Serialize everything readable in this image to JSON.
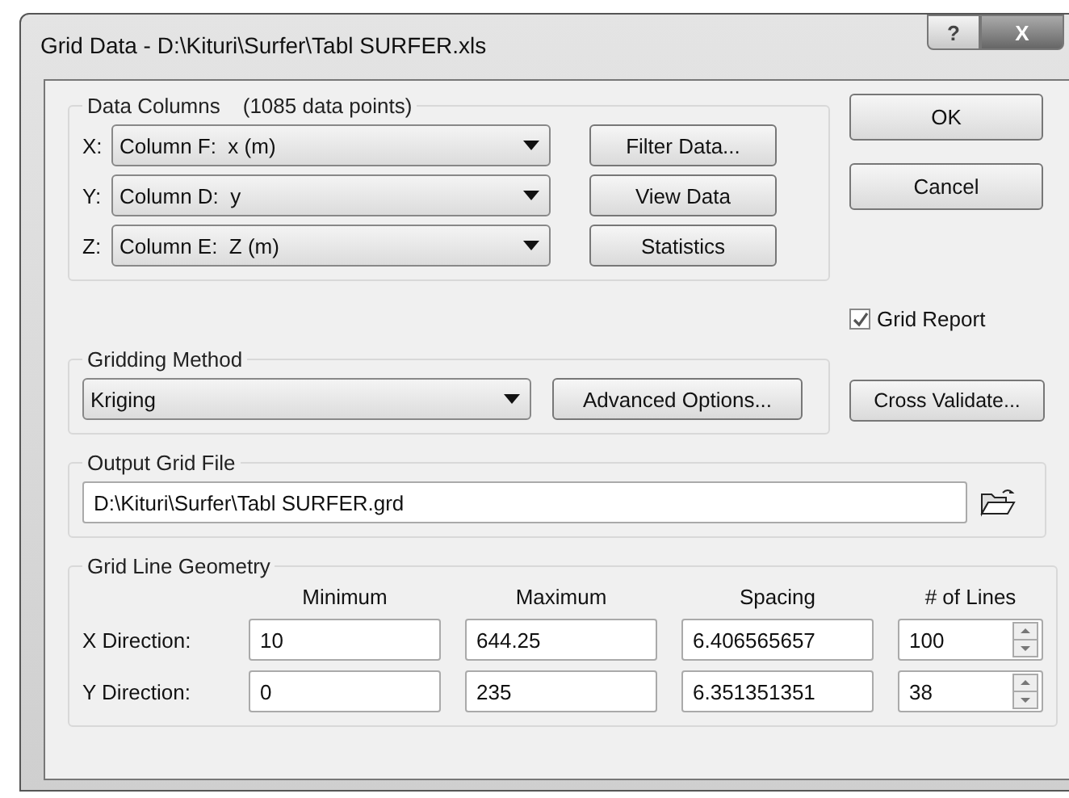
{
  "window": {
    "title": "Grid Data - D:\\Kituri\\Surfer\\Tabl SURFER.xls",
    "help_button": "?",
    "close_button": "X"
  },
  "data_columns": {
    "title": "Data Columns",
    "count": "(1085 data points)",
    "rows": [
      {
        "label": "X:",
        "value": "Column F:  x (m)",
        "button": "Filter Data..."
      },
      {
        "label": "Y:",
        "value": "Column D:  y",
        "button": "View Data"
      },
      {
        "label": "Z:",
        "value": "Column E:  Z (m)",
        "button": "Statistics"
      }
    ]
  },
  "buttons": [
    "OK",
    "Cancel"
  ],
  "grid_report": {
    "label": "Grid Report",
    "checked": true
  },
  "gridding_method": {
    "title": "Gridding Method",
    "value": "Kriging",
    "button": "Advanced Options..."
  },
  "cross_validate": "Cross Validate...",
  "output_grid_file": {
    "title": "Output Grid File",
    "value": "D:\\Kituri\\Surfer\\Tabl SURFER.grd"
  },
  "grid_line_geometry": {
    "title": "Grid Line Geometry",
    "columns": [
      "Minimum",
      "Maximum",
      "Spacing",
      "# of Lines"
    ],
    "rows": [
      {
        "label": "X Direction:",
        "minimum": "10",
        "maximum": "644.25",
        "spacing": "6.406565657",
        "lines": "100"
      },
      {
        "label": "Y Direction:",
        "minimum": "0",
        "maximum": "235",
        "spacing": "6.351351351",
        "lines": "38"
      }
    ]
  }
}
